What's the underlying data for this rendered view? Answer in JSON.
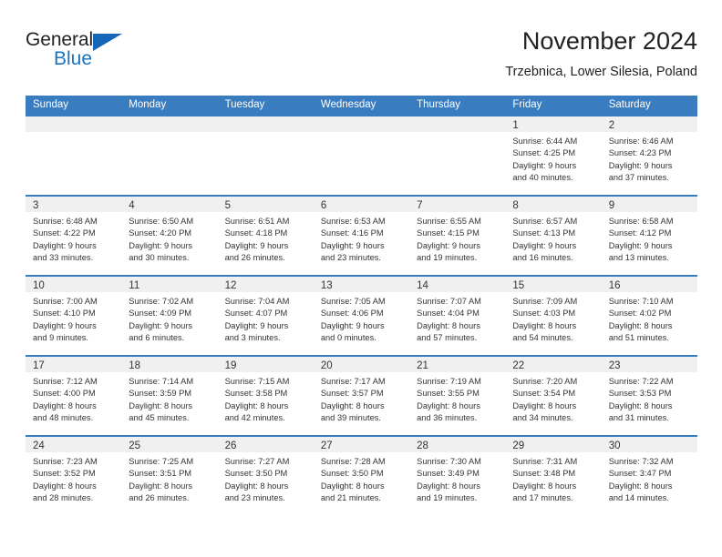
{
  "brand": {
    "name_part1": "General",
    "name_part2": "Blue",
    "logo_icon": "blue-triangle-logo"
  },
  "header": {
    "title": "November 2024",
    "subtitle": "Trzebnica, Lower Silesia, Poland"
  },
  "colors": {
    "header_blue": "#3a7cc0",
    "brand_blue": "#1a73c0",
    "day_band_gray": "#f0f0f0",
    "text": "#333333"
  },
  "weekdays": [
    "Sunday",
    "Monday",
    "Tuesday",
    "Wednesday",
    "Thursday",
    "Friday",
    "Saturday"
  ],
  "labels": {
    "sunrise_prefix": "Sunrise:",
    "sunset_prefix": "Sunset:",
    "daylight_prefix": "Daylight:"
  },
  "weeks": [
    [
      {
        "day": "",
        "empty": true
      },
      {
        "day": "",
        "empty": true
      },
      {
        "day": "",
        "empty": true
      },
      {
        "day": "",
        "empty": true
      },
      {
        "day": "",
        "empty": true
      },
      {
        "day": "1",
        "line1": "Sunrise: 6:44 AM",
        "line2": "Sunset: 4:25 PM",
        "line3": "Daylight: 9 hours",
        "line4": "and 40 minutes."
      },
      {
        "day": "2",
        "line1": "Sunrise: 6:46 AM",
        "line2": "Sunset: 4:23 PM",
        "line3": "Daylight: 9 hours",
        "line4": "and 37 minutes."
      }
    ],
    [
      {
        "day": "3",
        "line1": "Sunrise: 6:48 AM",
        "line2": "Sunset: 4:22 PM",
        "line3": "Daylight: 9 hours",
        "line4": "and 33 minutes."
      },
      {
        "day": "4",
        "line1": "Sunrise: 6:50 AM",
        "line2": "Sunset: 4:20 PM",
        "line3": "Daylight: 9 hours",
        "line4": "and 30 minutes."
      },
      {
        "day": "5",
        "line1": "Sunrise: 6:51 AM",
        "line2": "Sunset: 4:18 PM",
        "line3": "Daylight: 9 hours",
        "line4": "and 26 minutes."
      },
      {
        "day": "6",
        "line1": "Sunrise: 6:53 AM",
        "line2": "Sunset: 4:16 PM",
        "line3": "Daylight: 9 hours",
        "line4": "and 23 minutes."
      },
      {
        "day": "7",
        "line1": "Sunrise: 6:55 AM",
        "line2": "Sunset: 4:15 PM",
        "line3": "Daylight: 9 hours",
        "line4": "and 19 minutes."
      },
      {
        "day": "8",
        "line1": "Sunrise: 6:57 AM",
        "line2": "Sunset: 4:13 PM",
        "line3": "Daylight: 9 hours",
        "line4": "and 16 minutes."
      },
      {
        "day": "9",
        "line1": "Sunrise: 6:58 AM",
        "line2": "Sunset: 4:12 PM",
        "line3": "Daylight: 9 hours",
        "line4": "and 13 minutes."
      }
    ],
    [
      {
        "day": "10",
        "line1": "Sunrise: 7:00 AM",
        "line2": "Sunset: 4:10 PM",
        "line3": "Daylight: 9 hours",
        "line4": "and 9 minutes."
      },
      {
        "day": "11",
        "line1": "Sunrise: 7:02 AM",
        "line2": "Sunset: 4:09 PM",
        "line3": "Daylight: 9 hours",
        "line4": "and 6 minutes."
      },
      {
        "day": "12",
        "line1": "Sunrise: 7:04 AM",
        "line2": "Sunset: 4:07 PM",
        "line3": "Daylight: 9 hours",
        "line4": "and 3 minutes."
      },
      {
        "day": "13",
        "line1": "Sunrise: 7:05 AM",
        "line2": "Sunset: 4:06 PM",
        "line3": "Daylight: 9 hours",
        "line4": "and 0 minutes."
      },
      {
        "day": "14",
        "line1": "Sunrise: 7:07 AM",
        "line2": "Sunset: 4:04 PM",
        "line3": "Daylight: 8 hours",
        "line4": "and 57 minutes."
      },
      {
        "day": "15",
        "line1": "Sunrise: 7:09 AM",
        "line2": "Sunset: 4:03 PM",
        "line3": "Daylight: 8 hours",
        "line4": "and 54 minutes."
      },
      {
        "day": "16",
        "line1": "Sunrise: 7:10 AM",
        "line2": "Sunset: 4:02 PM",
        "line3": "Daylight: 8 hours",
        "line4": "and 51 minutes."
      }
    ],
    [
      {
        "day": "17",
        "line1": "Sunrise: 7:12 AM",
        "line2": "Sunset: 4:00 PM",
        "line3": "Daylight: 8 hours",
        "line4": "and 48 minutes."
      },
      {
        "day": "18",
        "line1": "Sunrise: 7:14 AM",
        "line2": "Sunset: 3:59 PM",
        "line3": "Daylight: 8 hours",
        "line4": "and 45 minutes."
      },
      {
        "day": "19",
        "line1": "Sunrise: 7:15 AM",
        "line2": "Sunset: 3:58 PM",
        "line3": "Daylight: 8 hours",
        "line4": "and 42 minutes."
      },
      {
        "day": "20",
        "line1": "Sunrise: 7:17 AM",
        "line2": "Sunset: 3:57 PM",
        "line3": "Daylight: 8 hours",
        "line4": "and 39 minutes."
      },
      {
        "day": "21",
        "line1": "Sunrise: 7:19 AM",
        "line2": "Sunset: 3:55 PM",
        "line3": "Daylight: 8 hours",
        "line4": "and 36 minutes."
      },
      {
        "day": "22",
        "line1": "Sunrise: 7:20 AM",
        "line2": "Sunset: 3:54 PM",
        "line3": "Daylight: 8 hours",
        "line4": "and 34 minutes."
      },
      {
        "day": "23",
        "line1": "Sunrise: 7:22 AM",
        "line2": "Sunset: 3:53 PM",
        "line3": "Daylight: 8 hours",
        "line4": "and 31 minutes."
      }
    ],
    [
      {
        "day": "24",
        "line1": "Sunrise: 7:23 AM",
        "line2": "Sunset: 3:52 PM",
        "line3": "Daylight: 8 hours",
        "line4": "and 28 minutes."
      },
      {
        "day": "25",
        "line1": "Sunrise: 7:25 AM",
        "line2": "Sunset: 3:51 PM",
        "line3": "Daylight: 8 hours",
        "line4": "and 26 minutes."
      },
      {
        "day": "26",
        "line1": "Sunrise: 7:27 AM",
        "line2": "Sunset: 3:50 PM",
        "line3": "Daylight: 8 hours",
        "line4": "and 23 minutes."
      },
      {
        "day": "27",
        "line1": "Sunrise: 7:28 AM",
        "line2": "Sunset: 3:50 PM",
        "line3": "Daylight: 8 hours",
        "line4": "and 21 minutes."
      },
      {
        "day": "28",
        "line1": "Sunrise: 7:30 AM",
        "line2": "Sunset: 3:49 PM",
        "line3": "Daylight: 8 hours",
        "line4": "and 19 minutes."
      },
      {
        "day": "29",
        "line1": "Sunrise: 7:31 AM",
        "line2": "Sunset: 3:48 PM",
        "line3": "Daylight: 8 hours",
        "line4": "and 17 minutes."
      },
      {
        "day": "30",
        "line1": "Sunrise: 7:32 AM",
        "line2": "Sunset: 3:47 PM",
        "line3": "Daylight: 8 hours",
        "line4": "and 14 minutes."
      }
    ]
  ]
}
